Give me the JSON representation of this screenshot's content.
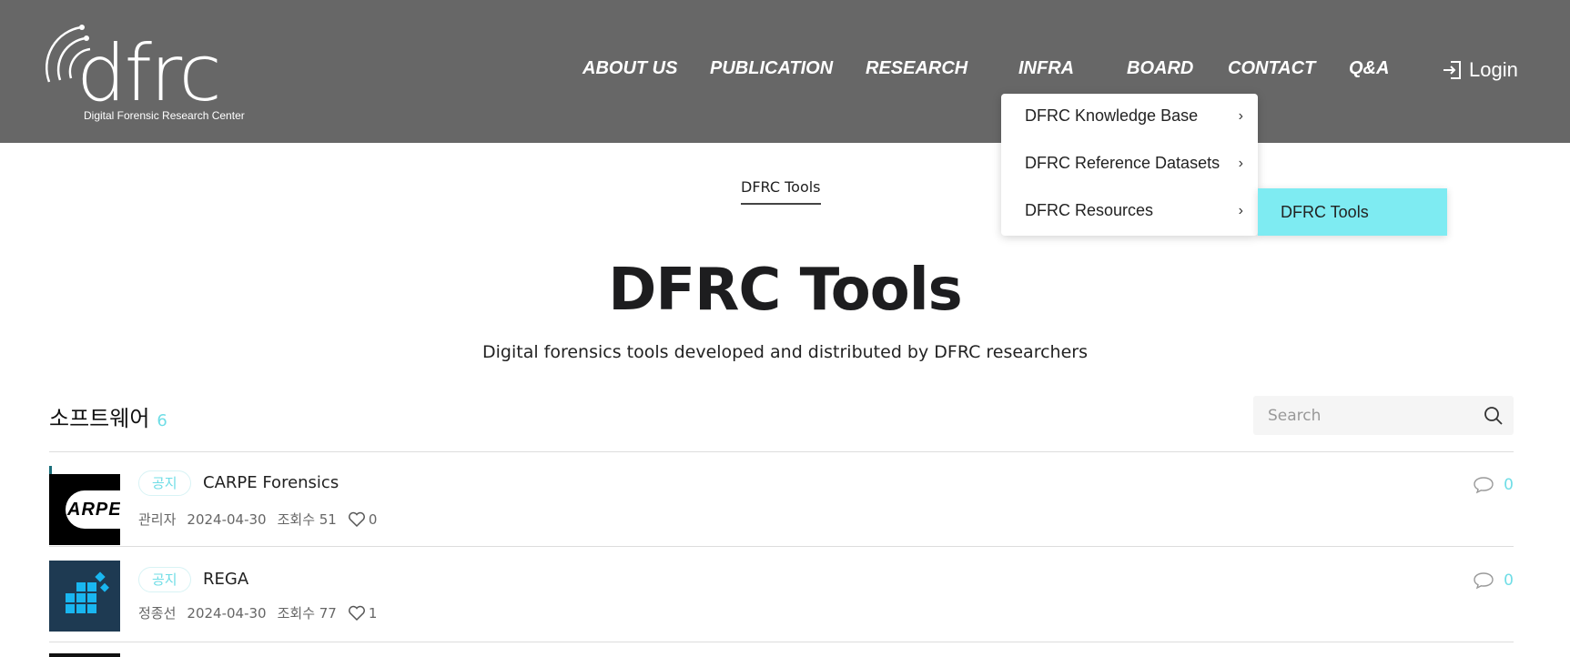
{
  "header": {
    "logo_text": "dfrc",
    "logo_subtitle": "Digital Forensic Research Center",
    "nav": [
      {
        "label": "ABOUT US"
      },
      {
        "label": "PUBLICATION"
      },
      {
        "label": "RESEARCH"
      },
      {
        "label": "INFRA"
      },
      {
        "label": "BOARD"
      },
      {
        "label": "CONTACT"
      },
      {
        "label": "Q&A"
      }
    ],
    "login_label": "Login"
  },
  "dropdown": {
    "items": [
      {
        "label": "DFRC Knowledge Base"
      },
      {
        "label": "DFRC Reference Datasets"
      },
      {
        "label": "DFRC Resources"
      }
    ],
    "submenu": {
      "label": "DFRC Tools"
    }
  },
  "breadcrumb": "DFRC Tools",
  "page": {
    "title": "DFRC Tools",
    "description": "Digital forensics tools developed and distributed by DFRC researchers"
  },
  "section": {
    "title": "소프트웨어",
    "count": "6"
  },
  "search": {
    "placeholder": "Search"
  },
  "posts": [
    {
      "tag": "공지",
      "title": "CARPE Forensics",
      "thumb_text": "ARPE",
      "author": "관리자",
      "date": "2024-04-30",
      "views": "조회수 51",
      "likes": "0",
      "comments": "0"
    },
    {
      "tag": "공지",
      "title": "REGA",
      "author": "정종선",
      "date": "2024-04-30",
      "views": "조회수 77",
      "likes": "1",
      "comments": "0"
    }
  ],
  "colors": {
    "header_bg": "#676767",
    "accent": "#6fdde6",
    "submenu_bg": "#7eebf2"
  }
}
